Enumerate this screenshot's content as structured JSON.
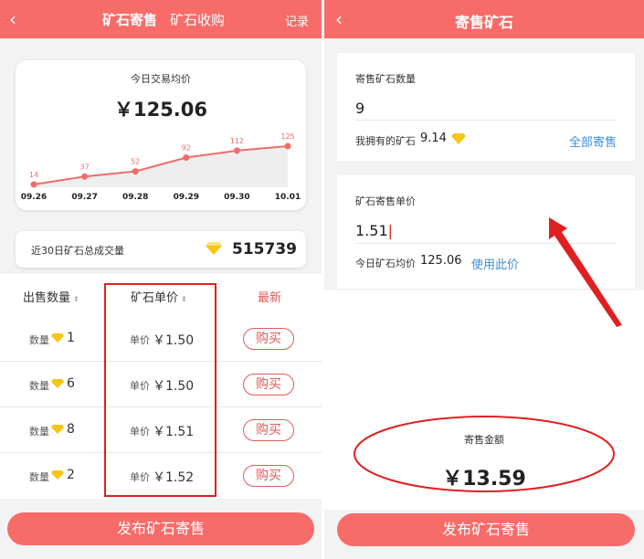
{
  "left": {
    "back_icon": "chevron-left-icon",
    "tab_active": "矿石寄售",
    "tab_other": "矿石收购",
    "records": "记录",
    "avg_label": "今日交易均价",
    "avg_price": "￥125.06",
    "chart_data": {
      "type": "area",
      "categories": [
        "09.26",
        "09.27",
        "09.28",
        "09.29",
        "09.30",
        "10.01"
      ],
      "values": [
        14,
        37,
        52,
        92,
        112,
        125
      ],
      "line_color": "#f26b6b"
    },
    "volume_label": "近30日矿石总成交量",
    "volume_value": "515739",
    "col_qty": "出售数量",
    "col_price": "矿石单价",
    "col_latest": "最新",
    "qty_prefix": "数量",
    "price_prefix": "单价",
    "buy_label": "购买",
    "rows": [
      {
        "qty": "1",
        "price": "￥1.50"
      },
      {
        "qty": "6",
        "price": "￥1.50"
      },
      {
        "qty": "8",
        "price": "￥1.51"
      },
      {
        "qty": "2",
        "price": "￥1.52"
      }
    ],
    "publish_label": "发布矿石寄售"
  },
  "right": {
    "title": "寄售矿石",
    "qty_label": "寄售矿石数量",
    "qty_value": "9",
    "own_label": "我拥有的矿石",
    "own_value": "9.14",
    "sell_all": "全部寄售",
    "price_label": "矿石寄售单价",
    "price_value": "1.51",
    "avg_label": "今日矿石均价",
    "avg_value": "125.06",
    "use_price": "使用此价",
    "total_label": "寄售金额",
    "total_value": "￥13.59",
    "publish_label": "发布矿石寄售"
  },
  "colors": {
    "accent": "#f76b69",
    "annotation": "#e02020",
    "link": "#3b8fd6",
    "gem": "#f5c518"
  }
}
